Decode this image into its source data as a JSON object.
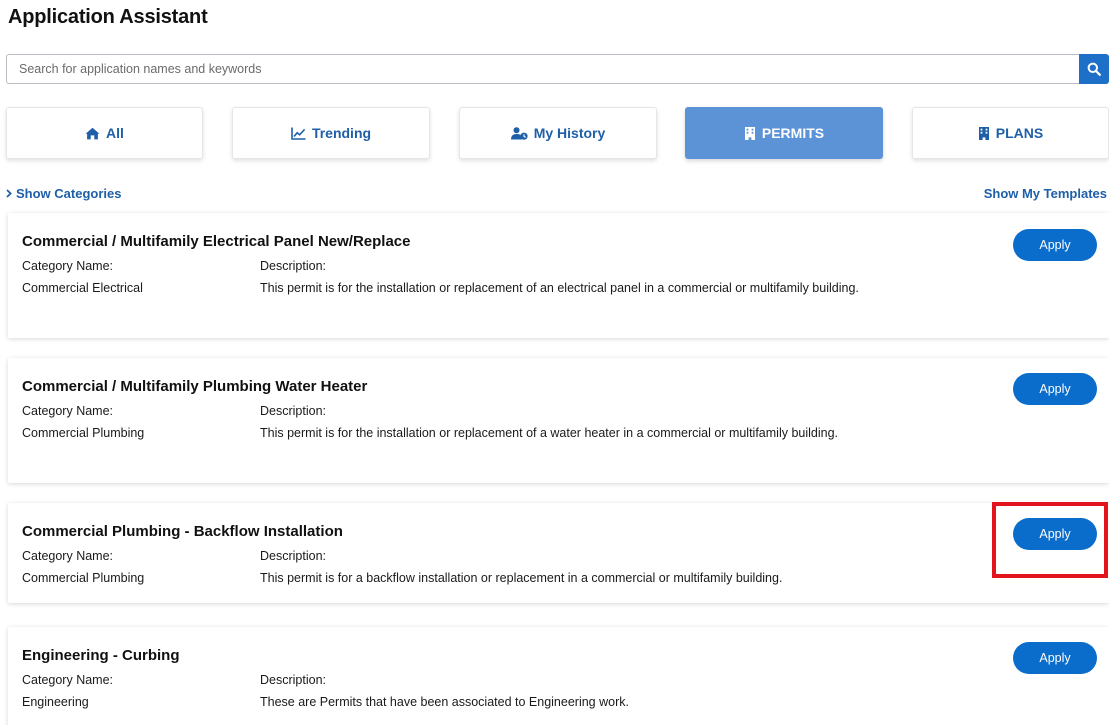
{
  "page": {
    "title": "Application Assistant"
  },
  "search": {
    "placeholder": "Search for application names and keywords",
    "value": "",
    "button_icon": "search-icon"
  },
  "tabs": [
    {
      "label": "All",
      "icon": "home-icon",
      "active": false
    },
    {
      "label": "Trending",
      "icon": "trending-chart-icon",
      "active": false
    },
    {
      "label": "My History",
      "icon": "user-history-icon",
      "active": false
    },
    {
      "label": "PERMITS",
      "icon": "building-icon",
      "active": true
    },
    {
      "label": "PLANS",
      "icon": "building-icon",
      "active": false
    }
  ],
  "links": {
    "show_categories": "Show Categories",
    "show_templates": "Show My Templates"
  },
  "cards": [
    {
      "title": "Commercial / Multifamily Electrical Panel New/Replace",
      "category_label": "Category Name:",
      "category": "Commercial Electrical",
      "description_label": "Description:",
      "description": "This permit is for the installation or replacement of an electrical panel in a commercial or multifamily building.",
      "apply_label": "Apply"
    },
    {
      "title": "Commercial / Multifamily Plumbing Water Heater",
      "category_label": "Category Name:",
      "category": "Commercial Plumbing",
      "description_label": "Description:",
      "description": "This permit is for the installation or replacement of a water heater in a commercial or multifamily building.",
      "apply_label": "Apply"
    },
    {
      "title": "Commercial Plumbing - Backflow Installation",
      "category_label": "Category Name:",
      "category": "Commercial Plumbing",
      "description_label": "Description:",
      "description": "This permit is for a backflow installation or replacement in a commercial or multifamily building.",
      "apply_label": "Apply"
    },
    {
      "title": "Engineering - Curbing",
      "category_label": "Category Name:",
      "category": "Engineering",
      "description_label": "Description:",
      "description": "These are Permits that have been associated to Engineering work.",
      "apply_label": "Apply"
    }
  ],
  "colors": {
    "accent": "#0a6ccb",
    "active_tab": "#5b93d6",
    "link": "#1e5fa8",
    "highlight": "#e3141b"
  }
}
